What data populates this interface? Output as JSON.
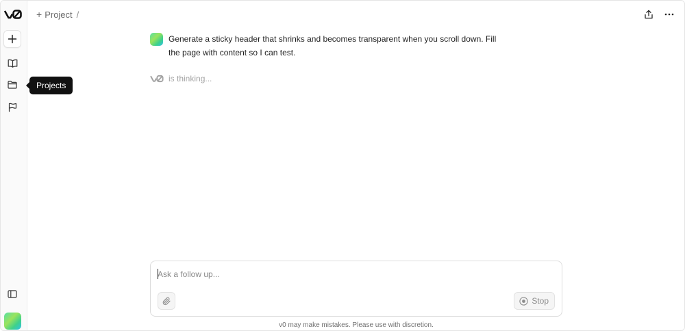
{
  "sidebar": {
    "new_chat_icon": "plus-icon",
    "library_icon": "book-open-icon",
    "projects_icon": "folder-icon",
    "feedback_icon": "flag-icon",
    "toggle_icon": "sidebar-icon",
    "tooltip": "Projects"
  },
  "header": {
    "add_symbol": "+",
    "project_label": "Project",
    "separator": "/",
    "share_icon": "share-icon",
    "more_icon": "more-horizontal-icon"
  },
  "chat": {
    "user_message": "Generate a sticky header that shrinks and becomes transparent when you scroll down. Fill the page with content so I can test.",
    "status_text": "is thinking..."
  },
  "composer": {
    "placeholder": "Ask a follow up...",
    "value": "",
    "attach_icon": "paperclip-icon",
    "stop_label": "Stop",
    "stop_icon": "stop-circle-icon"
  },
  "footer": {
    "disclaimer": "v0 may make mistakes. Please use with discretion."
  },
  "colors": {
    "accent_gradient_start": "#56e0a4",
    "accent_gradient_end": "#2fc1e6",
    "tooltip_bg": "#111111"
  }
}
